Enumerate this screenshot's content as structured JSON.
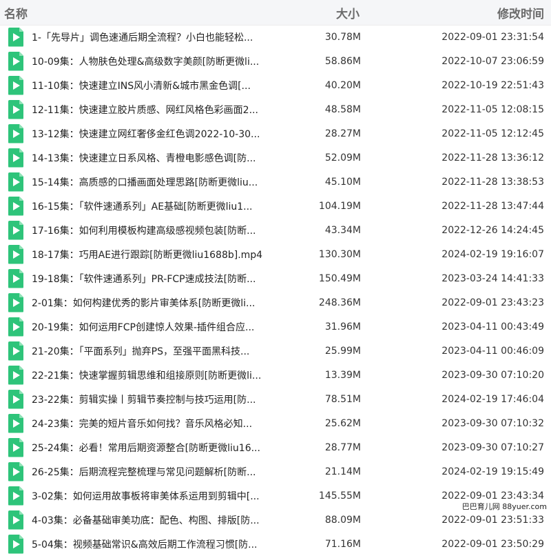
{
  "header": {
    "name": "名称",
    "size": "大小",
    "time": "修改时间"
  },
  "rows": [
    {
      "name": "1-「先导片」调色速通后期全流程？小白也能轻松...",
      "size": "30.78M",
      "time": "2022-09-01 23:31:54"
    },
    {
      "name": "10-09集：人物肤色处理&高级数字美颜[防断更微li...",
      "size": "58.86M",
      "time": "2022-10-07 23:06:59"
    },
    {
      "name": "11-10集：快速建立INS风小清新&城市黑金色调[...",
      "size": "40.20M",
      "time": "2022-10-19 22:51:43"
    },
    {
      "name": "12-11集：快速建立胶片质感、网红风格色彩画面2...",
      "size": "48.58M",
      "time": "2022-11-05 12:08:15"
    },
    {
      "name": "13-12集：快速建立网红奢侈金红色调2022-10-30...",
      "size": "28.27M",
      "time": "2022-11-05 12:12:45"
    },
    {
      "name": "14-13集：快速建立日系风格、青橙电影感色调[防...",
      "size": "52.09M",
      "time": "2022-11-28 13:36:12"
    },
    {
      "name": "15-14集：高质感的口播画面处理思路[防断更微liu...",
      "size": "45.10M",
      "time": "2022-11-28 13:38:53"
    },
    {
      "name": "16-15集：「软件速通系列」AE基础[防断更微liu1...",
      "size": "104.19M",
      "time": "2022-11-28 13:47:44"
    },
    {
      "name": "17-16集：如何利用模板构建高级感视频包装[防断...",
      "size": "43.34M",
      "time": "2022-12-26 14:24:45"
    },
    {
      "name": "18-17集：巧用AE进行跟踪[防断更微liu1688b].mp4",
      "size": "130.30M",
      "time": "2024-02-19 19:16:07"
    },
    {
      "name": "19-18集：「软件速通系列」PR-FCP速成技法[防断...",
      "size": "150.49M",
      "time": "2023-03-24 14:41:33"
    },
    {
      "name": "2-01集：如何构建优秀的影片审美体系[防断更微li...",
      "size": "248.36M",
      "time": "2022-09-01 23:43:23"
    },
    {
      "name": "20-19集：如何运用FCP创建惊人效果-插件组合应...",
      "size": "31.96M",
      "time": "2023-04-11 00:43:49"
    },
    {
      "name": "21-20集：「平面系列」抛弃PS，至强平面黑科技...",
      "size": "25.99M",
      "time": "2023-04-11 00:46:09"
    },
    {
      "name": "22-21集：快速掌握剪辑思维和组接原则[防断更微li...",
      "size": "13.39M",
      "time": "2023-09-30 07:10:20"
    },
    {
      "name": "23-22集：剪辑实操丨剪辑节奏控制与技巧运用[防...",
      "size": "78.51M",
      "time": "2024-02-19 17:46:04"
    },
    {
      "name": "24-23集：完美的短片音乐如何找？音乐风格必知...",
      "size": "25.62M",
      "time": "2023-09-30 07:10:32"
    },
    {
      "name": "25-24集：必看！常用后期资源整合[防断更微liu16...",
      "size": "28.77M",
      "time": "2023-09-30 07:10:27"
    },
    {
      "name": "26-25集：后期流程完整梳理与常见问题解析[防断...",
      "size": "21.14M",
      "time": "2024-02-19 19:15:49"
    },
    {
      "name": "3-02集：如何运用故事板将审美体系运用到剪辑中[...",
      "size": "145.55M",
      "time": "2022-09-01 23:43:34"
    },
    {
      "name": "4-03集：必备基础审美功底：配色、构图、排版[防...",
      "size": "88.09M",
      "time": "2022-09-01 23:51:33"
    },
    {
      "name": "5-04集：视频基础常识&高效后期工作流程习惯[防...",
      "size": "71.16M",
      "time": "2022-09-01 23:50:29"
    }
  ],
  "watermark": "巴巴育儿网 88yuer.com",
  "colors": {
    "icon": "#2ec47a",
    "header_bg": "#f5f6f8"
  },
  "icon": "video-file-icon"
}
